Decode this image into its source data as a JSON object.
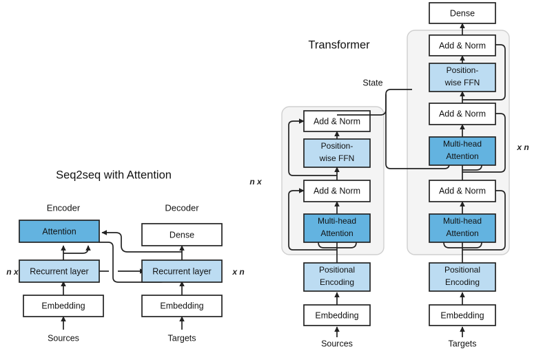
{
  "figure": {
    "kind": "architecture-diagram",
    "background": "#ffffff",
    "colors": {
      "box_white": "#ffffff",
      "box_mid_blue": "#63b3e0",
      "box_light_blue": "#bcdcf2",
      "panel_fill": "#f4f4f4",
      "panel_stroke": "#cfcfcf",
      "line": "#222222",
      "text": "#111111"
    }
  },
  "left_diagram": {
    "title": "Seq2seq with Attention",
    "encoder_label": "Encoder",
    "decoder_label": "Decoder",
    "repeat_left": "n x",
    "repeat_right": "x n",
    "encoder_stack": [
      {
        "label": "Attention",
        "style": "mid-blue"
      },
      {
        "label": "Recurrent layer",
        "style": "light-blue"
      },
      {
        "label": "Embedding",
        "style": "white"
      }
    ],
    "decoder_stack": [
      {
        "label": "Dense",
        "style": "white"
      },
      {
        "label": "Recurrent layer",
        "style": "light-blue"
      },
      {
        "label": "Embedding",
        "style": "white"
      }
    ],
    "input_source": "Sources",
    "input_target": "Targets"
  },
  "right_diagram": {
    "title": "Transformer",
    "state_label": "State",
    "output_label": "Dense",
    "repeat_left": "n x",
    "repeat_right": "x n",
    "encoder_block": [
      {
        "label": "Add & Norm",
        "style": "white"
      },
      {
        "label_line1": "Position-",
        "label_line2": "wise FFN",
        "style": "light-blue"
      },
      {
        "label": "Add & Norm",
        "style": "white"
      },
      {
        "label_line1": "Multi-head",
        "label_line2": "Attention",
        "style": "mid-blue"
      }
    ],
    "encoder_base": [
      {
        "label_line1": "Positional",
        "label_line2": "Encoding",
        "style": "light-blue"
      },
      {
        "label": "Embedding",
        "style": "white"
      }
    ],
    "decoder_block": [
      {
        "label": "Add & Norm",
        "style": "white"
      },
      {
        "label_line1": "Position-",
        "label_line2": "wise FFN",
        "style": "light-blue"
      },
      {
        "label": "Add & Norm",
        "style": "white"
      },
      {
        "label_line1": "Multi-head",
        "label_line2": "Attention",
        "style": "mid-blue"
      },
      {
        "label": "Add & Norm",
        "style": "white"
      },
      {
        "label_line1": "Multi-head",
        "label_line2": "Attention",
        "style": "mid-blue"
      }
    ],
    "decoder_base": [
      {
        "label_line1": "Positional",
        "label_line2": "Encoding",
        "style": "light-blue"
      },
      {
        "label": "Embedding",
        "style": "white"
      }
    ],
    "input_source": "Sources",
    "input_target": "Targets"
  }
}
